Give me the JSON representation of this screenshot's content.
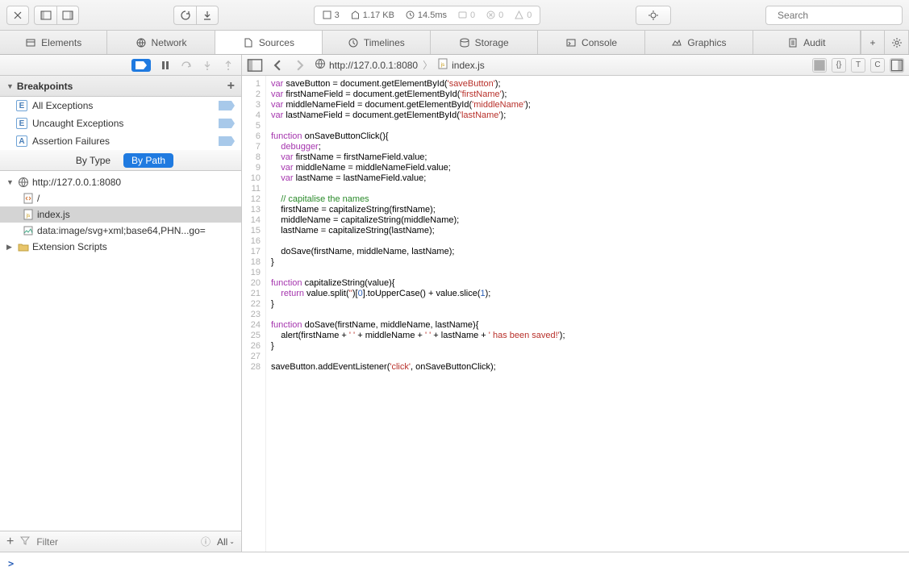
{
  "toolbar": {
    "status": {
      "requests": "3",
      "size": "1.17 KB",
      "time": "14.5ms",
      "logs": "0",
      "errors": "0",
      "warnings": "0"
    },
    "search_placeholder": "Search"
  },
  "tabs": [
    {
      "label": "Elements"
    },
    {
      "label": "Network"
    },
    {
      "label": "Sources"
    },
    {
      "label": "Timelines"
    },
    {
      "label": "Storage"
    },
    {
      "label": "Console"
    },
    {
      "label": "Graphics"
    },
    {
      "label": "Audit"
    }
  ],
  "sidebar": {
    "breakpoints_title": "Breakpoints",
    "bp_items": [
      {
        "label": "All Exceptions"
      },
      {
        "label": "Uncaught Exceptions"
      },
      {
        "label": "Assertion Failures"
      }
    ],
    "filter_by_type": "By Type",
    "filter_by_path": "By Path",
    "tree": {
      "host": "http://127.0.0.1:8080",
      "items": [
        {
          "label": "/"
        },
        {
          "label": "index.js"
        },
        {
          "label": "data:image/svg+xml;base64,PHN...go="
        }
      ],
      "ext_scripts": "Extension Scripts"
    },
    "filter_placeholder": "Filter",
    "all_label": "All"
  },
  "editor": {
    "breadcrumb": {
      "host": "http://127.0.0.1:8080",
      "file": "index.js"
    },
    "lines": 28,
    "code": [
      [
        [
          "kw",
          "var"
        ],
        [
          "id",
          " saveButton = document.getElementById("
        ],
        [
          "str",
          "'saveButton'"
        ],
        [
          "id",
          ");"
        ]
      ],
      [
        [
          "kw",
          "var"
        ],
        [
          "id",
          " firstNameField = document.getElementById("
        ],
        [
          "str",
          "'firstName'"
        ],
        [
          "id",
          ");"
        ]
      ],
      [
        [
          "kw",
          "var"
        ],
        [
          "id",
          " middleNameField = document.getElementById("
        ],
        [
          "str",
          "'middleName'"
        ],
        [
          "id",
          ");"
        ]
      ],
      [
        [
          "kw",
          "var"
        ],
        [
          "id",
          " lastNameField = document.getElementById("
        ],
        [
          "str",
          "'lastName'"
        ],
        [
          "id",
          ");"
        ]
      ],
      [],
      [
        [
          "kw",
          "function"
        ],
        [
          "id",
          " onSaveButtonClick(){"
        ]
      ],
      [
        [
          "id",
          "    "
        ],
        [
          "kw",
          "debugger"
        ],
        [
          "id",
          ";"
        ]
      ],
      [
        [
          "id",
          "    "
        ],
        [
          "kw",
          "var"
        ],
        [
          "id",
          " firstName = firstNameField.value;"
        ]
      ],
      [
        [
          "id",
          "    "
        ],
        [
          "kw",
          "var"
        ],
        [
          "id",
          " middleName = middleNameField.value;"
        ]
      ],
      [
        [
          "id",
          "    "
        ],
        [
          "kw",
          "var"
        ],
        [
          "id",
          " lastName = lastNameField.value;"
        ]
      ],
      [],
      [
        [
          "id",
          "    "
        ],
        [
          "cm",
          "// capitalise the names"
        ]
      ],
      [
        [
          "id",
          "    firstName = capitalizeString(firstName);"
        ]
      ],
      [
        [
          "id",
          "    middleName = capitalizeString(middleName);"
        ]
      ],
      [
        [
          "id",
          "    lastName = capitalizeString(lastName);"
        ]
      ],
      [],
      [
        [
          "id",
          "    doSave(firstName, middleName, lastName);"
        ]
      ],
      [
        [
          "id",
          "}"
        ]
      ],
      [],
      [
        [
          "kw",
          "function"
        ],
        [
          "id",
          " capitalizeString(value){"
        ]
      ],
      [
        [
          "id",
          "    "
        ],
        [
          "kw",
          "return"
        ],
        [
          "id",
          " value.split("
        ],
        [
          "str",
          "''"
        ],
        [
          "id",
          ")["
        ],
        [
          "num",
          "0"
        ],
        [
          "id",
          "].toUpperCase() + value.slice("
        ],
        [
          "num",
          "1"
        ],
        [
          "id",
          ");"
        ]
      ],
      [
        [
          "id",
          "}"
        ]
      ],
      [],
      [
        [
          "kw",
          "function"
        ],
        [
          "id",
          " doSave(firstName, middleName, lastName){"
        ]
      ],
      [
        [
          "id",
          "    alert(firstName + "
        ],
        [
          "str",
          "' '"
        ],
        [
          "id",
          " + middleName + "
        ],
        [
          "str",
          "' '"
        ],
        [
          "id",
          " + lastName + "
        ],
        [
          "str",
          "' has been saved!'"
        ],
        [
          "id",
          ");"
        ]
      ],
      [
        [
          "id",
          "}"
        ]
      ],
      [],
      [
        [
          "id",
          "saveButton.addEventListener("
        ],
        [
          "str",
          "'click'"
        ],
        [
          "id",
          ", onSaveButtonClick);"
        ]
      ]
    ]
  },
  "console": {
    "prompt": ">"
  }
}
